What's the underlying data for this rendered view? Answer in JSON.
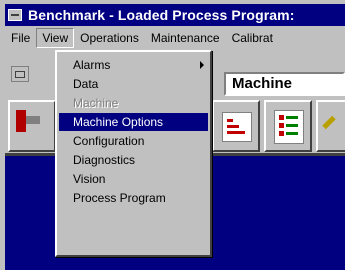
{
  "window": {
    "title": "Benchmark - Loaded Process Program:"
  },
  "menubar": {
    "items": [
      "File",
      "View",
      "Operations",
      "Maintenance",
      "Calibrat"
    ]
  },
  "toolbar": {
    "machine_field": "Machine"
  },
  "view_menu": {
    "items": [
      {
        "label": "Alarms",
        "submenu": true,
        "enabled": true
      },
      {
        "label": "Data",
        "enabled": true
      },
      {
        "label": "Machine",
        "enabled": false
      },
      {
        "label": "Machine Options",
        "enabled": true,
        "selected": true
      },
      {
        "label": "Configuration",
        "enabled": true
      },
      {
        "label": "Diagnostics",
        "enabled": true
      },
      {
        "label": "Vision",
        "enabled": true
      },
      {
        "label": "Process Program",
        "enabled": true
      }
    ]
  },
  "colors": {
    "titlebar": "#000080",
    "workarea": "#000080",
    "highlight": "#000080",
    "face": "#c0c0c0"
  }
}
